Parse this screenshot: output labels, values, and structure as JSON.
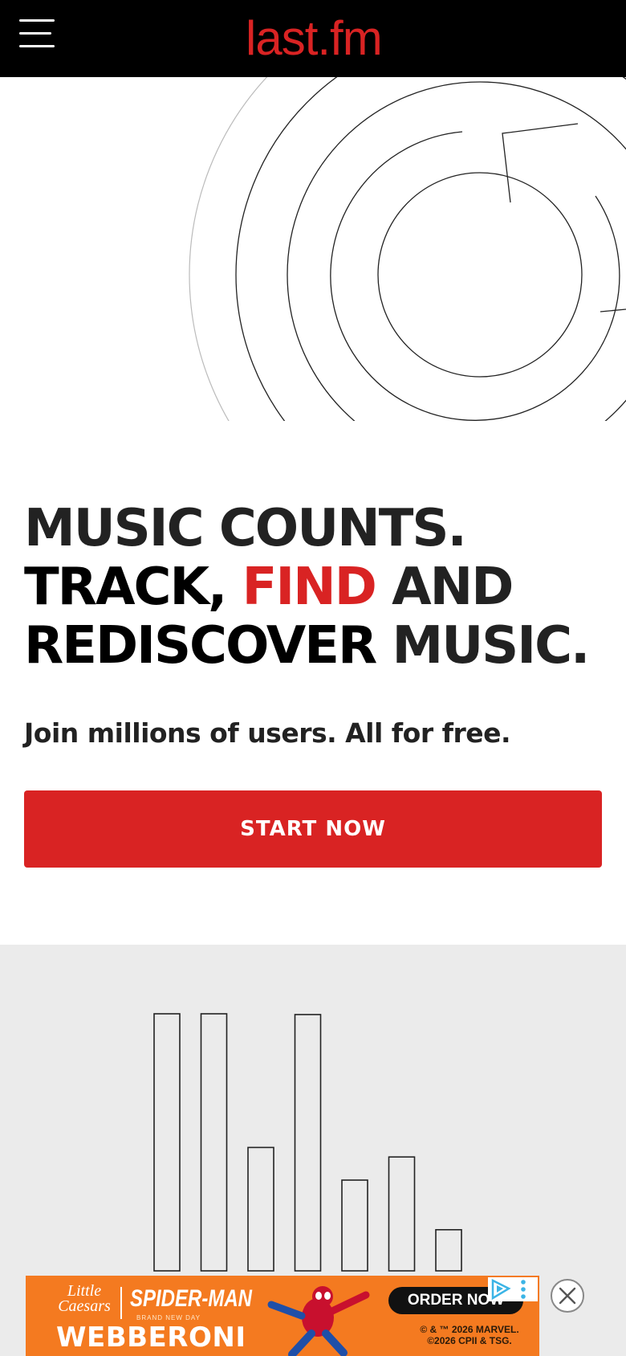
{
  "header": {
    "menu_icon": "hamburger-menu-icon",
    "logo_text": "last.fm",
    "background_color": "#000000",
    "logo_color": "#d92323"
  },
  "hero": {
    "illustration_icon": "concentric-rings-arrow-illustration",
    "headline": {
      "line1": "MUSIC COUNTS.",
      "line2_start": "TRACK, ",
      "line2_accent": "FIND",
      "line2_end": " AND",
      "line3_start": "REDISCOVER",
      "line3_end": " MUSIC."
    },
    "subheadline": "Join millions of users. All for free.",
    "cta_label": "START NOW",
    "accent_color": "#d92323"
  },
  "feature": {
    "illustration_icon": "bar-chart-illustration",
    "background_color": "#ebebeb",
    "bar_levels": [
      1.0,
      1.0,
      0.48,
      0.997,
      0.353,
      0.443,
      0.16
    ]
  },
  "ad": {
    "brand": "Little Caesars",
    "title": "SPIDER-MAN",
    "tagline": "BRAND NEW DAY",
    "product": "WEBBERONI",
    "cta": "ORDER NOW",
    "legal_line1": "© & ™ 2026 MARVEL.",
    "legal_line2": "©2026 CPII & TSG.",
    "background_color": "#f47a20",
    "choices_icon": "ad-choices-icon",
    "close_icon": "close-icon"
  }
}
